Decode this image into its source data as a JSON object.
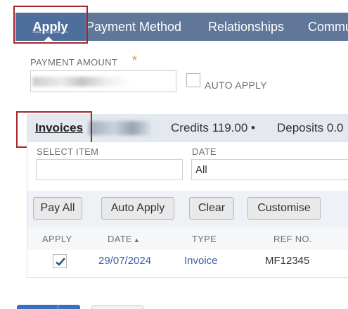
{
  "top_tabs": [
    {
      "label": "Apply",
      "active": true
    },
    {
      "label": "Payment Method"
    },
    {
      "label": "Relationships"
    },
    {
      "label": "Commu"
    }
  ],
  "payment": {
    "amount_label": "PAYMENT AMOUNT",
    "required_marker": "*",
    "auto_apply_label": "AUTO APPLY",
    "auto_apply_checked": false
  },
  "subtabs": {
    "invoices": "Invoices",
    "credits": "Credits 119.00 •",
    "deposits": "Deposits 0.0"
  },
  "filters": {
    "select_item_label": "SELECT ITEM",
    "date_label": "DATE",
    "date_value": "All"
  },
  "buttons": {
    "pay_all": "Pay All",
    "auto_apply": "Auto Apply",
    "clear": "Clear",
    "customise": "Customise"
  },
  "table": {
    "columns": [
      "APPLY",
      "DATE",
      "TYPE",
      "REF NO."
    ],
    "sort_indicator": "▲",
    "rows": [
      {
        "apply": true,
        "date": "29/07/2024",
        "type": "Invoice",
        "ref": "MF12345"
      }
    ]
  },
  "colors": {
    "tab_bar": "#607799",
    "highlight_box": "#a8242c",
    "link": "#3a61a0",
    "required": "#e59836"
  }
}
